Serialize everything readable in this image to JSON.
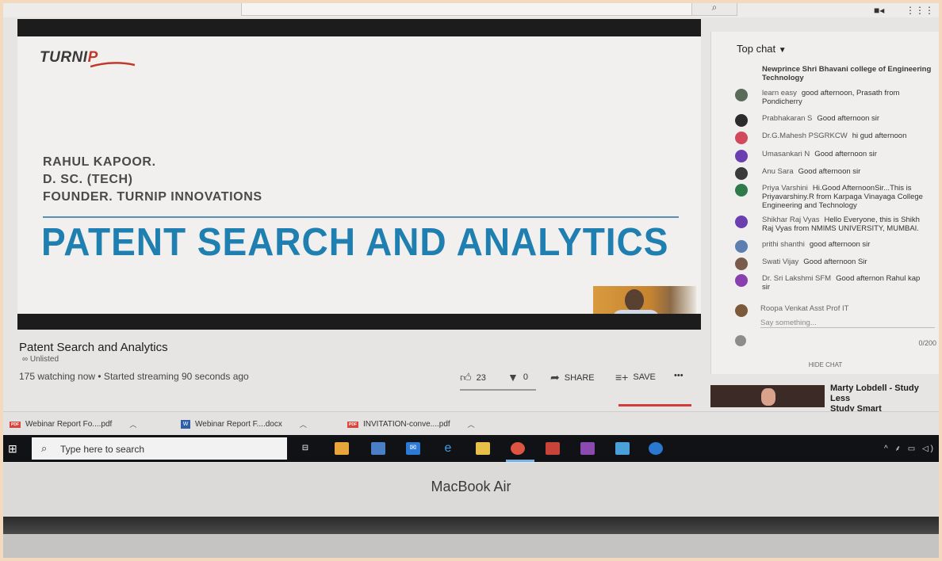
{
  "browser": {
    "search_icon": "search-icon",
    "toolbar_icons": [
      "video-camera-icon",
      "apps-grid-icon"
    ]
  },
  "video": {
    "logo_prefix": "TURNI",
    "logo_accent": "P",
    "speaker_name": "RAHUL KAPOOR.",
    "speaker_degree": "D. SC. (TECH)",
    "speaker_role": "FOUNDER. TURNIP INNOVATIONS",
    "slide_title": "PATENT SEARCH AND ANALYTICS",
    "title": "Patent Search and Analytics",
    "visibility": "Unlisted",
    "stats": "175 watching now • Started streaming 90 seconds ago",
    "likes": "23",
    "dislikes": "0",
    "share_label": "SHARE",
    "save_label": "SAVE",
    "more": "•••"
  },
  "chat": {
    "header": "Top chat",
    "messages": [
      {
        "author": "",
        "text": "Newprince Shri Bhavani college of Engineering",
        "cont": "Technology",
        "avatar": "none"
      },
      {
        "author": "learn easy",
        "text": "good afternoon, Prasath from",
        "cont": "Pondicherry",
        "avatar": "#5a6b5a"
      },
      {
        "author": "Prabhakaran S",
        "text": "Good afternoon sir",
        "cont": "",
        "avatar": "#2c2c2c"
      },
      {
        "author": "Dr.G.Mahesh PSGRKCW",
        "text": "hi gud afternoon",
        "cont": "",
        "avatar": "#d1495b"
      },
      {
        "author": "Umasankari N",
        "text": "Good afternoon sir",
        "cont": "",
        "avatar": "#6a3fb0"
      },
      {
        "author": "Anu Sara",
        "text": "Good afternoon sir",
        "cont": "",
        "avatar": "#3a3a3a"
      },
      {
        "author": "Priya Varshini",
        "text": "Hi.Good AfternoonSir...This is",
        "cont": "Priyavarshiny.R from Karpaga Vinayaga College",
        "cont2": "Engineering and Technology",
        "avatar": "#2f7a4a"
      },
      {
        "author": "Shikhar Raj Vyas",
        "text": "Hello Everyone, this is Shikh",
        "cont": "Raj Vyas from NMIMS UNIVERSITY, MUMBAI.",
        "avatar": "#6a3fb0"
      },
      {
        "author": "prithi shanthi",
        "text": "good afternoon sir",
        "cont": "",
        "avatar": "#5a7fb0"
      },
      {
        "author": "Swati Vijay",
        "text": "Good afternoon Sir",
        "cont": "",
        "avatar": "#7a5a4a"
      },
      {
        "author": "Dr. Sri Lakshmi SFM",
        "text": "Good afternon Rahul kap",
        "cont": "sir",
        "avatar": "#8a3fb0"
      }
    ],
    "current_user": "Roopa Venkat Asst Prof IT",
    "input_placeholder": "Say something...",
    "char_counter": "0/200",
    "hide_chat": "HIDE CHAT"
  },
  "recommended": {
    "title_line1": "Marty Lobdell - Study Less",
    "title_line2": "Study Smart"
  },
  "downloads": [
    {
      "name": "Webinar Report Fo....pdf",
      "type": "pdf"
    },
    {
      "name": "Webinar Report F....docx",
      "type": "docx"
    },
    {
      "name": "INVITATION-conve....pdf",
      "type": "pdf"
    }
  ],
  "taskbar": {
    "search_placeholder": "Type here to search",
    "icons": [
      "task-view-icon",
      "store-icon",
      "photos-icon",
      "mail-icon",
      "edge-icon",
      "file-explorer-icon",
      "chrome-icon",
      "acrobat-icon",
      "winrar-icon",
      "app-icon",
      "app-circle-icon"
    ],
    "tray": "^ ⸙ ▭ ◁)"
  },
  "device": {
    "label": "MacBook Air"
  }
}
